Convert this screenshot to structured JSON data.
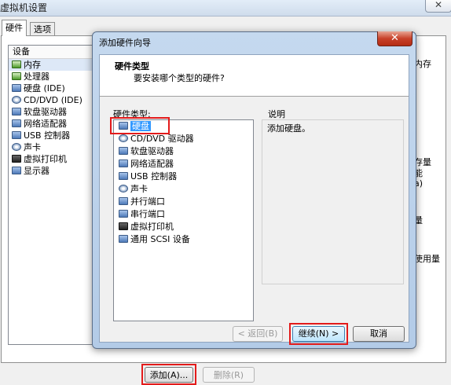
{
  "window": {
    "title": "虚拟机设置",
    "close_glyph": "✕"
  },
  "tabs": [
    "硬件",
    "选项"
  ],
  "device_list": {
    "header": "设备",
    "items": [
      {
        "label": "内存",
        "icon": "memory-icon"
      },
      {
        "label": "处理器",
        "icon": "processor-icon"
      },
      {
        "label": "硬盘 (IDE)",
        "icon": "hard-disk-icon"
      },
      {
        "label": "CD/DVD (IDE)",
        "icon": "cd-dvd-icon"
      },
      {
        "label": "软盘驱动器",
        "icon": "floppy-icon"
      },
      {
        "label": "网络适配器",
        "icon": "network-adapter-icon"
      },
      {
        "label": "USB 控制器",
        "icon": "usb-icon"
      },
      {
        "label": "声卡",
        "icon": "sound-card-icon"
      },
      {
        "label": "虚拟打印机",
        "icon": "printer-icon"
      },
      {
        "label": "显示器",
        "icon": "display-icon"
      }
    ]
  },
  "right_fragments": [
    "内存",
    "存量",
    "能",
    "a)",
    "量",
    "使用量"
  ],
  "bottom_buttons": {
    "add": "添加(A)...",
    "remove": "删除(R)"
  },
  "dialog": {
    "title": "添加硬件向导",
    "close_glyph": "✕",
    "header_title": "硬件类型",
    "header_subtitle": "要安装哪个类型的硬件?",
    "list_label": "硬件类型:",
    "hardware_types": [
      {
        "label": "硬盘",
        "icon": "hard-disk-icon"
      },
      {
        "label": "CD/DVD 驱动器",
        "icon": "cd-dvd-icon"
      },
      {
        "label": "软盘驱动器",
        "icon": "floppy-icon"
      },
      {
        "label": "网络适配器",
        "icon": "network-adapter-icon"
      },
      {
        "label": "USB 控制器",
        "icon": "usb-icon"
      },
      {
        "label": "声卡",
        "icon": "sound-card-icon"
      },
      {
        "label": "并行端口",
        "icon": "parallel-port-icon"
      },
      {
        "label": "串行端口",
        "icon": "serial-port-icon"
      },
      {
        "label": "虚拟打印机",
        "icon": "printer-icon"
      },
      {
        "label": "通用 SCSI 设备",
        "icon": "scsi-icon"
      }
    ],
    "description_label": "说明",
    "description_text": "添加硬盘。",
    "buttons": {
      "back": "< 返回(B)",
      "next": "继续(N) >",
      "cancel": "取消"
    }
  },
  "colors": {
    "selection": "#3399ff",
    "annotation": "#e31b1b",
    "dialog_frame": "#b3cbe7"
  }
}
